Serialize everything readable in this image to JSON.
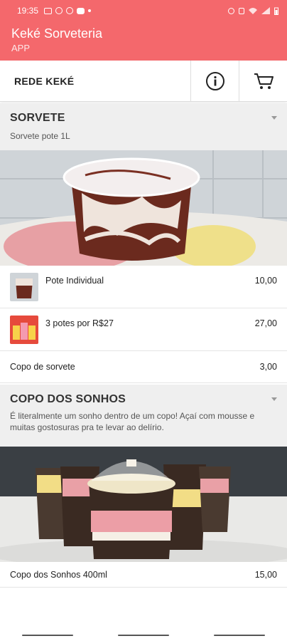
{
  "status_bar": {
    "time": "19:35"
  },
  "app": {
    "title": "Keké Sorveteria",
    "subtitle": "APP"
  },
  "toolbar": {
    "store_name": "REDE KEKÉ",
    "info_icon": "info-icon",
    "cart_icon": "cart-icon"
  },
  "sections": [
    {
      "title": "SORVETE",
      "description": "Sorvete pote 1L",
      "items": [
        {
          "name": "Pote Individual",
          "price": "10,00"
        },
        {
          "name": "3 potes por R$27",
          "price": "27,00"
        },
        {
          "name": "Copo de sorvete",
          "price": "3,00"
        }
      ]
    },
    {
      "title": "COPO DOS SONHOS",
      "description": "É literalmente um sonho dentro de um copo! Açaí com mousse e muitas gostosuras pra te levar ao delírio.",
      "items": [
        {
          "name": "Copo dos Sonhos 400ml",
          "price": "15,00"
        }
      ]
    }
  ],
  "colors": {
    "brand": "#f4686c"
  }
}
